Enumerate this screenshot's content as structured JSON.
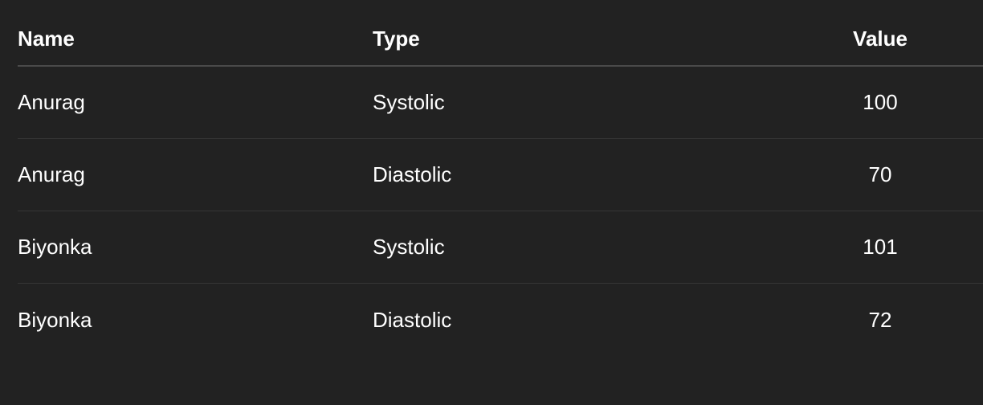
{
  "table": {
    "columns": [
      "Name",
      "Type",
      "Value"
    ],
    "rows": [
      {
        "name": "Anurag",
        "type": "Systolic",
        "value": "100"
      },
      {
        "name": "Anurag",
        "type": "Diastolic",
        "value": "70"
      },
      {
        "name": "Biyonka",
        "type": "Systolic",
        "value": "101"
      },
      {
        "name": "Biyonka",
        "type": "Diastolic",
        "value": "72"
      }
    ]
  },
  "colors": {
    "background": "#222222",
    "text": "#ffffff",
    "header_divider": "#4a4a4a",
    "row_divider": "#363636"
  }
}
